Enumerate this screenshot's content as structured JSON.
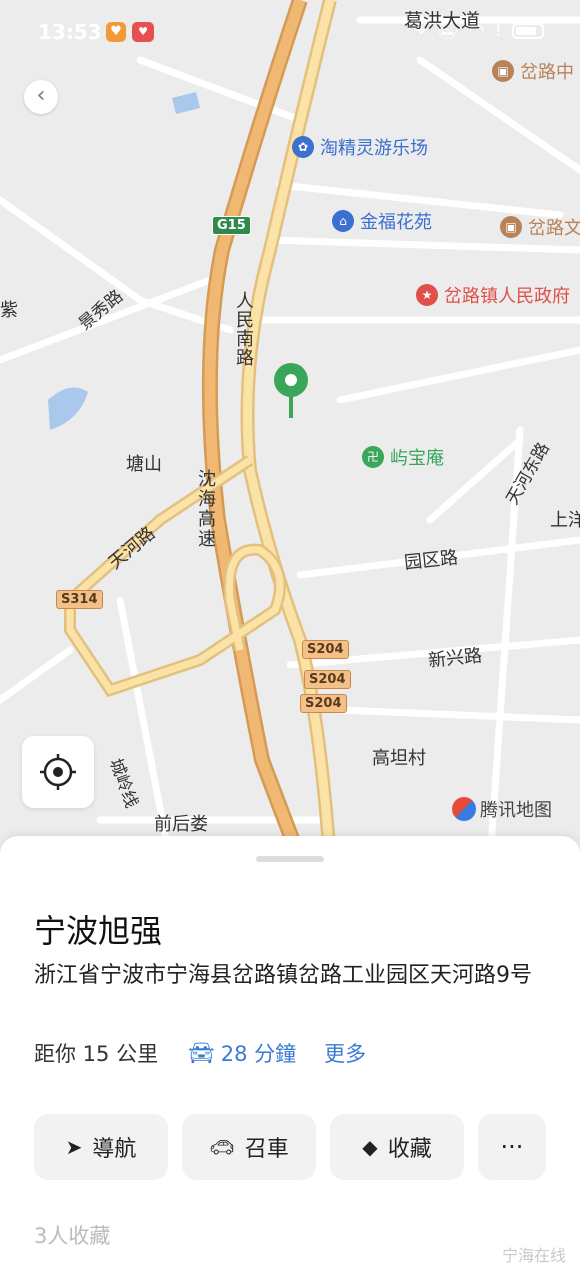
{
  "status_bar": {
    "time": "13:53",
    "app_badge_1": "♥",
    "app_badge_2": "♥"
  },
  "map": {
    "road_labels": [
      "葛洪大道",
      "人民南路",
      "景秀路",
      "沈海高速",
      "天河路",
      "天河东路",
      "园区路",
      "新兴路",
      "城岭线"
    ],
    "place_labels": [
      "塘山",
      "高坦村",
      "前后娄",
      "上洋",
      "紫"
    ],
    "pois": [
      {
        "name": "淘精灵游乐场",
        "color": "#3b6fd0"
      },
      {
        "name": "金福花苑",
        "color": "#3b6fd0"
      },
      {
        "name": "岔路镇人民政府",
        "color": "#e0504a"
      },
      {
        "name": "屿宝庵",
        "color": "#3aa65a"
      },
      {
        "name": "岔路中",
        "color": "#b9835a"
      },
      {
        "name": "岔路文",
        "color": "#b9835a"
      }
    ],
    "route_shields": [
      "G15",
      "S314",
      "S204",
      "S204",
      "S204"
    ],
    "provider_logo": "腾讯地图"
  },
  "place": {
    "name": "宁波旭强",
    "address": "浙江省宁波市宁海县岔路镇岔路工业园区天河路9号",
    "distance": "距你 15 公里",
    "drive_time": "28 分鐘",
    "more": "更多"
  },
  "actions": {
    "navigate": "導航",
    "ride": "召車",
    "favorite": "收藏",
    "overflow": "···"
  },
  "favorites_count": "3人收藏",
  "watermark": "宁海在线"
}
